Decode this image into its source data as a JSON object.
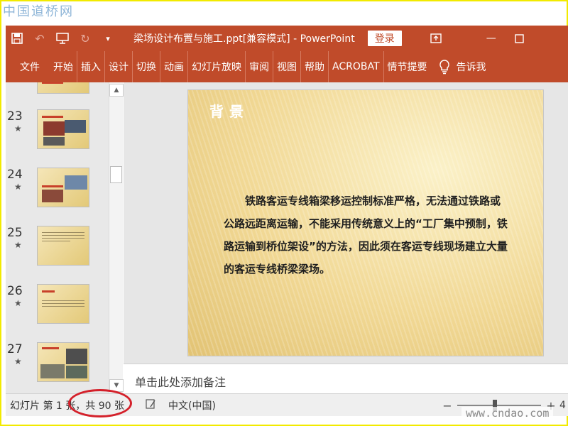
{
  "watermark_top": "中国道桥网",
  "watermark_bottom": "www.cndao.com",
  "titlebar": {
    "title": "梁场设计布置与施工.ppt[兼容模式] - PowerPoint",
    "login_label": "登录"
  },
  "ribbon": {
    "tabs": [
      "文件",
      "开始",
      "插入",
      "设计",
      "切换",
      "动画",
      "幻灯片放映",
      "审阅",
      "视图",
      "帮助",
      "ACROBAT",
      "情节提要"
    ],
    "tell_me": "告诉我"
  },
  "thumbnails": [
    {
      "number": "23",
      "star": "★"
    },
    {
      "number": "24",
      "star": "★"
    },
    {
      "number": "25",
      "star": "★"
    },
    {
      "number": "26",
      "star": "★"
    },
    {
      "number": "27",
      "star": "★"
    }
  ],
  "slide": {
    "title": "背景",
    "body": "铁路客运专线箱梁移运控制标准严格，无法通过铁路或公路远距离运输，不能采用传统意义上的“工厂集中预制，铁路运输到桥位架设”的方法，因此须在客运专线现场建立大量的客运专线桥梁梁场。"
  },
  "notes": {
    "placeholder": "单击此处添加备注"
  },
  "status": {
    "slide_info": "幻灯片 第 1 张，共 90 张",
    "language": "中文(中国)",
    "zoom_minus": "−",
    "zoom_plus": "+",
    "zoom_pct": "4"
  },
  "colors": {
    "accent": "#c04b2a",
    "highlight_border": "#f2ea00",
    "annotation": "#d4202a"
  }
}
